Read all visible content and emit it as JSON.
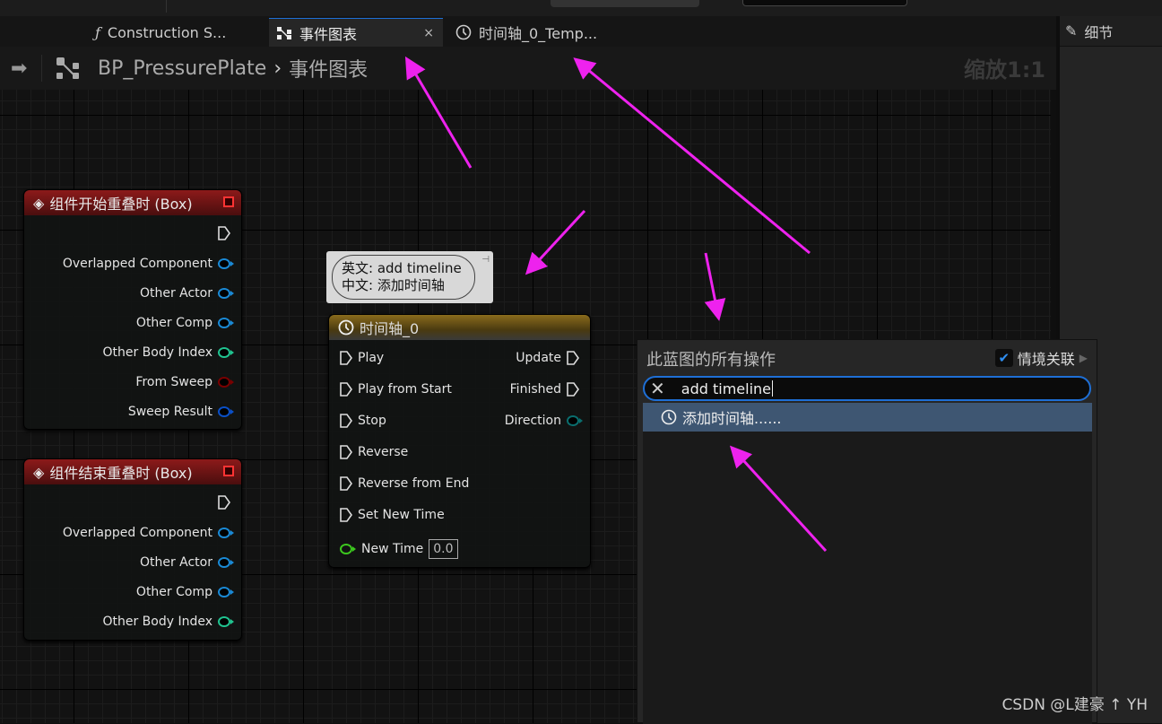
{
  "tabs": [
    {
      "label": "Construction S...",
      "icon": "function-icon"
    },
    {
      "label": "事件图表",
      "icon": "graph-icon",
      "active": true,
      "close": "×"
    },
    {
      "label": "时间轴_0_Temp...",
      "icon": "clock-icon"
    }
  ],
  "breadcrumb": {
    "blueprint": "BP_PressurePlate",
    "separator": "›",
    "graph": "事件图表"
  },
  "zoom_label": "缩放1:1",
  "details_panel": {
    "title": "细节"
  },
  "nodes": {
    "begin_overlap": {
      "title": "组件开始重叠时 (Box)",
      "pins": [
        {
          "label": "Overlapped Component",
          "color": "#1a8ad6"
        },
        {
          "label": "Other Actor",
          "color": "#1a8ad6"
        },
        {
          "label": "Other Comp",
          "color": "#1a8ad6"
        },
        {
          "label": "Other Body Index",
          "color": "#20c490"
        },
        {
          "label": "From Sweep",
          "color": "#7a0000"
        },
        {
          "label": "Sweep Result",
          "color": "#0a50c8"
        }
      ]
    },
    "end_overlap": {
      "title": "组件结束重叠时 (Box)",
      "pins": [
        {
          "label": "Overlapped Component",
          "color": "#1a8ad6"
        },
        {
          "label": "Other Actor",
          "color": "#1a8ad6"
        },
        {
          "label": "Other Comp",
          "color": "#1a8ad6"
        },
        {
          "label": "Other Body Index",
          "color": "#20c490"
        }
      ]
    },
    "timeline": {
      "title": "时间轴_0",
      "inputs": [
        "Play",
        "Play from Start",
        "Stop",
        "Reverse",
        "Reverse from End",
        "Set New Time"
      ],
      "outputs": [
        "Update",
        "Finished"
      ],
      "direction": "Direction",
      "new_time_label": "New Time",
      "new_time_value": "0.0"
    }
  },
  "comment": {
    "line1": "英文: add timeline",
    "line2": "中文: 添加时间轴"
  },
  "action_menu": {
    "title": "此蓝图的所有操作",
    "context_label": "情境关联",
    "context_checked": true,
    "search_value": "add timeline",
    "results": [
      {
        "label": "添加时间轴......",
        "icon": "clock-icon"
      }
    ]
  },
  "watermark": "CSDN @L建豪 ↑ YH",
  "colors": {
    "accent": "#1e6fd6",
    "annotation_arrow": "#ee22ee",
    "selected_row": "#3e5672"
  }
}
